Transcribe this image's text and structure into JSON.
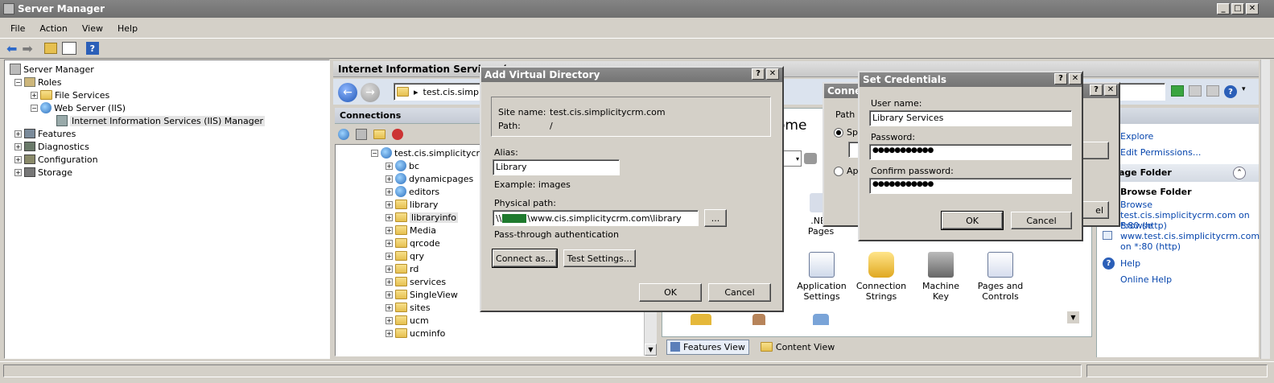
{
  "window": {
    "title": "Server Manager"
  },
  "menu": [
    "File",
    "Action",
    "View",
    "Help"
  ],
  "tree": {
    "root": "Server Manager",
    "roles": "Roles",
    "file_services": "File Services",
    "web_server": "Web Server (IIS)",
    "iis_manager": "Internet Information Services (IIS) Manager",
    "features": "Features",
    "diagnostics": "Diagnostics",
    "configuration": "Configuration",
    "storage": "Storage"
  },
  "iis": {
    "header": "Internet Information Services (",
    "address": "test.cis.simpl",
    "connections_label": "Connections",
    "site": "test.cis.simplicitycrm",
    "folders": [
      "bc",
      "dynamicpages",
      "editors",
      "library",
      "libraryinfo",
      "Media",
      "qrcode",
      "qry",
      "rd",
      "services",
      "SingleView",
      "sites",
      "ucm",
      "ucminfo"
    ],
    "home_fragment": "ome",
    "tiles": [
      {
        "label": ".NET\nPages"
      },
      {
        "label": "Application\nSettings"
      },
      {
        "label": "Connection\nStrings"
      },
      {
        "label": "Machine Key"
      },
      {
        "label": "Pages and\nControls"
      }
    ],
    "features_view": "Features View",
    "content_view": "Content View",
    "actions_header_fragment": "ions",
    "actions": {
      "explore": "Explore",
      "edit_permissions": "Edit Permissions...",
      "manage_folder": "age Folder",
      "browse_folder": "Browse Folder",
      "browse1": "Browse test.cis.simplicitycrm.com on *:80 (http)",
      "browse2": "Browse www.test.cis.simplicitycrm.com on *:80 (http)",
      "help": "Help",
      "online_help": "Online Help"
    }
  },
  "add_vdir": {
    "title": "Add Virtual Directory",
    "site_name_label": "Site name:",
    "site_name": "test.cis.simplicitycrm.com",
    "path_label": "Path:",
    "path": "/",
    "alias_label": "Alias:",
    "alias": "Library",
    "example": "Example: images",
    "physical_label": "Physical path:",
    "physical_prefix": "\\\\",
    "physical_suffix": "\\www.cis.simplicitycrm.com\\library",
    "browse_btn": "...",
    "passthrough": "Pass-through authentication",
    "connect_as": "Connect as...",
    "test_settings": "Test Settings...",
    "ok": "OK",
    "cancel": "Cancel"
  },
  "connect_as": {
    "title_fragment": "Conne",
    "path_fragment": "Path",
    "sp": "Sp",
    "ap": "Ap",
    "cancel_fragment": "el"
  },
  "set_credentials": {
    "title": "Set Credentials",
    "username_label": "User name:",
    "username": "Library Services",
    "password_label": "Password:",
    "password": "●●●●●●●●●●●",
    "confirm_label": "Confirm password:",
    "confirm": "●●●●●●●●●●●",
    "ok": "OK",
    "cancel": "Cancel"
  },
  "help_symbol": "?",
  "close_symbol": "✕"
}
